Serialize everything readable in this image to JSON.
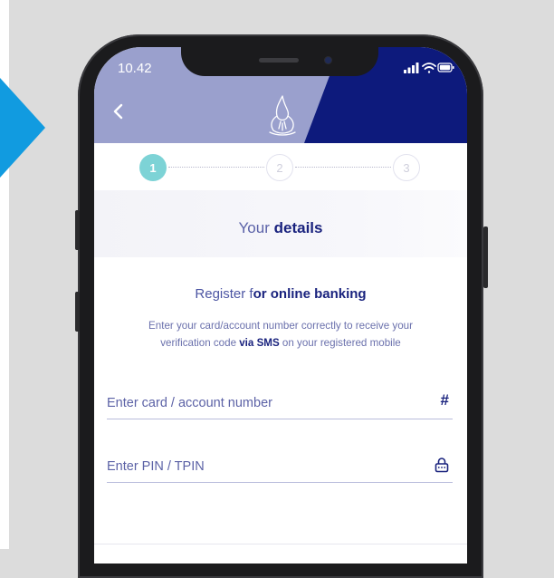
{
  "status_bar": {
    "time": "10.42"
  },
  "stepper": {
    "steps": [
      "1",
      "2",
      "3"
    ],
    "current": 1
  },
  "section": {
    "title_light": "Your ",
    "title_bold": "details"
  },
  "intro": {
    "title_light": "Register f",
    "title_bold": "or online banking",
    "desc_part1": "Enter your card/account number correctly to receive your verification code ",
    "desc_bold": "via SMS",
    "desc_part2": " on your registered mobile"
  },
  "form": {
    "card_placeholder": "Enter card / account number",
    "card_icon": "#",
    "pin_placeholder": "Enter PIN / TPIN"
  },
  "colors": {
    "header_light": "#9aa0cd",
    "header_dark": "#0d1a7c",
    "step_active": "#7dd3d6",
    "accent_arrow": "#119be0",
    "text_navy": "#1a237e"
  },
  "icons": [
    "back-chevron-icon",
    "logo-icon",
    "signal-icon",
    "wifi-icon",
    "battery-icon",
    "hash-icon",
    "lock-icon",
    "play-arrow-icon"
  ]
}
